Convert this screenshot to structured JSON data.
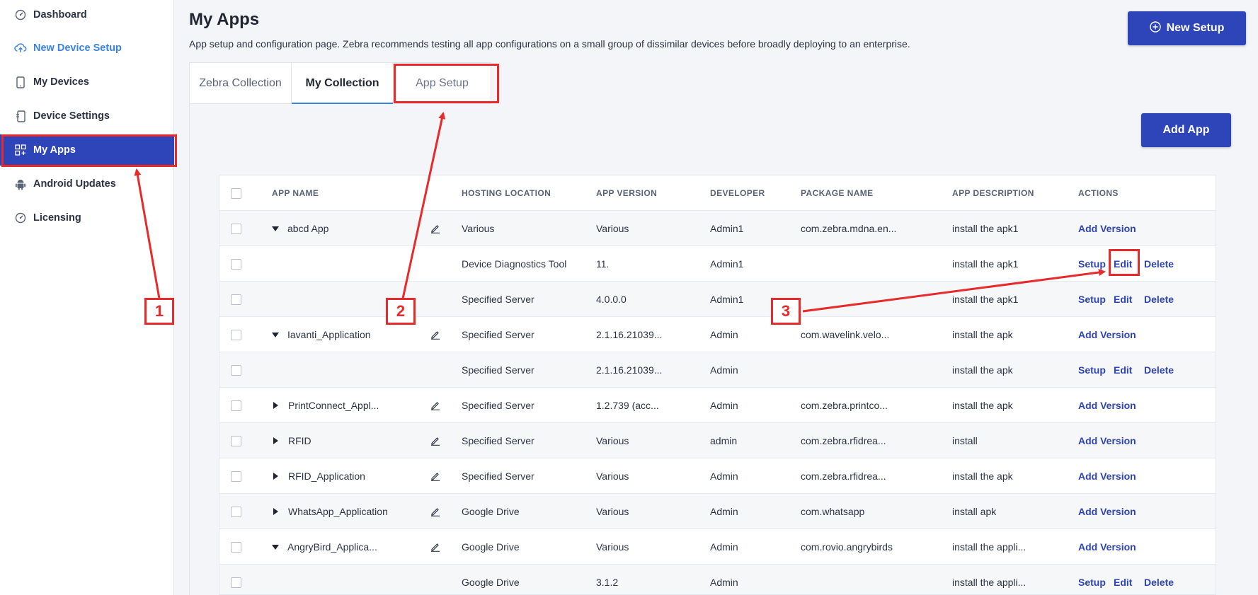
{
  "sidebar": {
    "items": [
      {
        "label": "Dashboard",
        "icon": "gauge-icon"
      },
      {
        "label": "New Device Setup",
        "icon": "cloud-upload-icon"
      },
      {
        "label": "My Devices",
        "icon": "phone-icon"
      },
      {
        "label": "Device Settings",
        "icon": "device-settings-icon"
      },
      {
        "label": "My Apps",
        "icon": "apps-grid-icon"
      },
      {
        "label": "Android Updates",
        "icon": "android-icon"
      },
      {
        "label": "Licensing",
        "icon": "gauge-icon"
      }
    ]
  },
  "header": {
    "title": "My Apps",
    "description": "App setup and configuration page. Zebra recommends testing all app configurations on a small group of dissimilar devices before broadly deploying to an enterprise.",
    "new_setup_label": "New Setup"
  },
  "tabs": [
    "Zebra Collection",
    "My Collection",
    "App Setup"
  ],
  "add_app_label": "Add App",
  "table": {
    "columns": [
      "APP NAME",
      "HOSTING LOCATION",
      "APP VERSION",
      "DEVELOPER",
      "PACKAGE NAME",
      "APP DESCRIPTION",
      "ACTIONS"
    ],
    "rows": [
      {
        "name": "abcd App",
        "caret": "down",
        "edit_icon": true,
        "hosting": "Various",
        "version": "Various",
        "developer": "Admin1",
        "package": "com.zebra.mdna.en...",
        "description": "install the apk1",
        "actions": [
          "Add Version"
        ]
      },
      {
        "name": "",
        "caret": "",
        "edit_icon": false,
        "hosting": "Device Diagnostics Tool",
        "version": "11.",
        "developer": "Admin1",
        "package": "",
        "description": "install the apk1",
        "actions": [
          "Setup",
          "Edit",
          "Delete"
        ]
      },
      {
        "name": "",
        "caret": "",
        "edit_icon": false,
        "hosting": "Specified Server",
        "version": "4.0.0.0",
        "developer": "Admin1",
        "package": "",
        "description": "install the apk1",
        "actions": [
          "Setup",
          "Edit",
          "Delete"
        ]
      },
      {
        "name": "Iavanti_Application",
        "caret": "down",
        "edit_icon": true,
        "hosting": "Specified Server",
        "version": "2.1.16.21039...",
        "developer": "Admin",
        "package": "com.wavelink.velo...",
        "description": "install the apk",
        "actions": [
          "Add Version"
        ]
      },
      {
        "name": "",
        "caret": "",
        "edit_icon": false,
        "hosting": "Specified Server",
        "version": "2.1.16.21039...",
        "developer": "Admin",
        "package": "",
        "description": "install the apk",
        "actions": [
          "Setup",
          "Edit",
          "Delete"
        ]
      },
      {
        "name": "PrintConnect_Appl...",
        "caret": "right",
        "edit_icon": true,
        "hosting": "Specified Server",
        "version": "1.2.739 (acc...",
        "developer": "Admin",
        "package": "com.zebra.printco...",
        "description": "install the apk",
        "actions": [
          "Add Version"
        ]
      },
      {
        "name": "RFID",
        "caret": "right",
        "edit_icon": true,
        "hosting": "Specified Server",
        "version": "Various",
        "developer": "admin",
        "package": "com.zebra.rfidrea...",
        "description": "install",
        "actions": [
          "Add Version"
        ]
      },
      {
        "name": "RFID_Application",
        "caret": "right",
        "edit_icon": true,
        "hosting": "Specified Server",
        "version": "Various",
        "developer": "Admin",
        "package": "com.zebra.rfidrea...",
        "description": "install the apk",
        "actions": [
          "Add Version"
        ]
      },
      {
        "name": "WhatsApp_Application",
        "caret": "right",
        "edit_icon": true,
        "hosting": "Google Drive",
        "version": "Various",
        "developer": "Admin",
        "package": "com.whatsapp",
        "description": "install apk",
        "actions": [
          "Add Version"
        ]
      },
      {
        "name": "AngryBird_Applica...",
        "caret": "down",
        "edit_icon": true,
        "hosting": "Google Drive",
        "version": "Various",
        "developer": "Admin",
        "package": "com.rovio.angrybirds",
        "description": "install the appli...",
        "actions": [
          "Add Version"
        ]
      },
      {
        "name": "",
        "caret": "",
        "edit_icon": false,
        "hosting": "Google Drive",
        "version": "3.1.2",
        "developer": "Admin",
        "package": "",
        "description": "install the appli...",
        "actions": [
          "Setup",
          "Edit",
          "Delete"
        ]
      }
    ]
  },
  "annotations": {
    "labels": [
      "1",
      "2",
      "3"
    ],
    "color": "#e82a2a"
  },
  "colors": {
    "primary": "#2e44b9",
    "accent": "#3b82e6",
    "annotation": "#e82a2a"
  }
}
